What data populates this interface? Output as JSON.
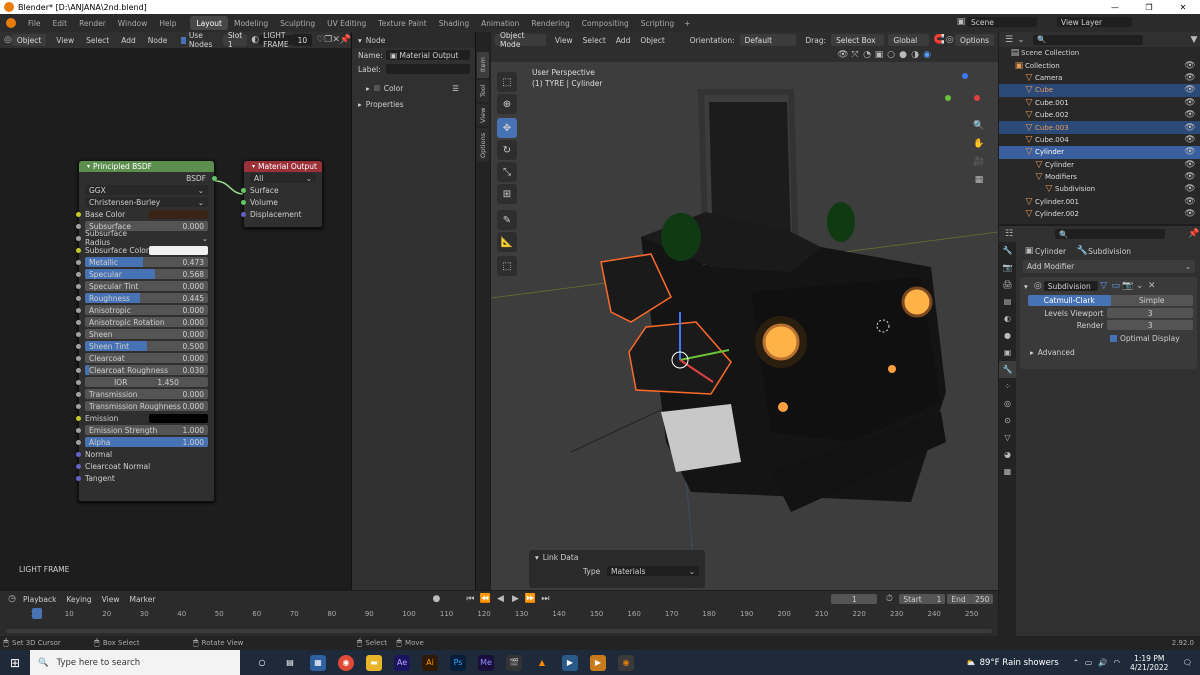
{
  "window": {
    "title": "Blender* [D:\\ANJANA\\2nd.blend]",
    "min": "—",
    "max": "❐",
    "close": "✕"
  },
  "menu": [
    "File",
    "Edit",
    "Render",
    "Window",
    "Help"
  ],
  "workspaces": [
    "Layout",
    "Modeling",
    "Sculpting",
    "UV Editing",
    "Texture Paint",
    "Shading",
    "Animation",
    "Rendering",
    "Compositing",
    "Scripting"
  ],
  "scene": "Scene",
  "view_layer": "View Layer",
  "node_header": {
    "mode": "Object",
    "view": "View",
    "select": "Select",
    "add": "Add",
    "node": "Node",
    "use_nodes": "Use Nodes",
    "slot": "Slot 1",
    "material": "LIGHT FRAME",
    "users": "10"
  },
  "bsdf": {
    "title": "Principled BSDF",
    "out": "BSDF",
    "distribution": "GGX",
    "subsurface_method": "Christensen-Burley",
    "base_color_label": "Base Color",
    "base_color": "#3a2418",
    "fields": [
      {
        "label": "Subsurface",
        "value": "0.000",
        "fill": 0
      },
      {
        "label": "Subsurface Radius",
        "value": "",
        "fill": 0,
        "dropdown": true
      },
      {
        "label": "Subsurface Color",
        "value": "",
        "fill": 0,
        "color": "#f0f0f0"
      },
      {
        "label": "Metallic",
        "value": "0.473",
        "fill": 0.473
      },
      {
        "label": "Specular",
        "value": "0.568",
        "fill": 0.568
      },
      {
        "label": "Specular Tint",
        "value": "0.000",
        "fill": 0
      },
      {
        "label": "Roughness",
        "value": "0.445",
        "fill": 0.445
      },
      {
        "label": "Anisotropic",
        "value": "0.000",
        "fill": 0
      },
      {
        "label": "Anisotropic Rotation",
        "value": "0.000",
        "fill": 0
      },
      {
        "label": "Sheen",
        "value": "0.000",
        "fill": 0
      },
      {
        "label": "Sheen Tint",
        "value": "0.500",
        "fill": 0.5
      },
      {
        "label": "Clearcoat",
        "value": "0.000",
        "fill": 0
      },
      {
        "label": "Clearcoat Roughness",
        "value": "0.030",
        "fill": 0.03
      },
      {
        "label": "IOR",
        "value": "1.450",
        "fill": 0,
        "center": true
      },
      {
        "label": "Transmission",
        "value": "0.000",
        "fill": 0
      },
      {
        "label": "Transmission Roughness",
        "value": "0.000",
        "fill": 0
      },
      {
        "label": "Emission",
        "value": "",
        "fill": 0,
        "color": "#000000",
        "plain": true
      },
      {
        "label": "Emission Strength",
        "value": "1.000",
        "fill": 0
      },
      {
        "label": "Alpha",
        "value": "1.000",
        "fill": 1
      }
    ],
    "inputs": [
      "Normal",
      "Clearcoat Normal",
      "Tangent"
    ]
  },
  "matout": {
    "title": "Material Output",
    "target": "All",
    "inputs": [
      "Surface",
      "Volume",
      "Displacement"
    ]
  },
  "node_editor_label": "LIGHT FRAME",
  "npanel": {
    "section": "Node",
    "name_label": "Name:",
    "name": "Material Output",
    "label_label": "Label:",
    "color": "Color",
    "properties": "Properties"
  },
  "ntabs": [
    "Item",
    "Tool",
    "View",
    "Options"
  ],
  "viewport": {
    "mode": "Object Mode",
    "view": "View",
    "select": "Select",
    "add": "Add",
    "object": "Object",
    "orientation_label": "Orientation:",
    "orientation": "Default",
    "drag_label": "Drag:",
    "drag": "Select Box",
    "transform": "Global",
    "options": "Options",
    "info1": "User Perspective",
    "info2": "(1) TYRE | Cylinder"
  },
  "link_panel": {
    "title": "Link Data",
    "type_label": "Type",
    "type": "Materials"
  },
  "outliner": {
    "root": "Scene Collection",
    "rows": [
      {
        "name": "Collection",
        "indent": 1,
        "color": "#ddd",
        "cls": ""
      },
      {
        "name": "Camera",
        "indent": 2,
        "color": "#ddd",
        "cls": ""
      },
      {
        "name": "Cube",
        "indent": 2,
        "color": "#e69a58",
        "cls": "sel"
      },
      {
        "name": "Cube.001",
        "indent": 2,
        "color": "#ddd",
        "cls": ""
      },
      {
        "name": "Cube.002",
        "indent": 2,
        "color": "#ddd",
        "cls": ""
      },
      {
        "name": "Cube.003",
        "indent": 2,
        "color": "#e69a58",
        "cls": "sel"
      },
      {
        "name": "Cube.004",
        "indent": 2,
        "color": "#ddd",
        "cls": ""
      },
      {
        "name": "Cylinder",
        "indent": 2,
        "color": "#fff",
        "cls": "act"
      },
      {
        "name": "Cylinder",
        "indent": 3,
        "color": "#ddd",
        "cls": ""
      },
      {
        "name": "Modifiers",
        "indent": 3,
        "color": "#ddd",
        "cls": ""
      },
      {
        "name": "Subdivision",
        "indent": 4,
        "color": "#ddd",
        "cls": ""
      },
      {
        "name": "Cylinder.001",
        "indent": 2,
        "color": "#ddd",
        "cls": ""
      },
      {
        "name": "Cylinder.002",
        "indent": 2,
        "color": "#ddd",
        "cls": ""
      }
    ]
  },
  "props": {
    "object": "Cylinder",
    "modifier": "Subdivision",
    "add_modifier": "Add Modifier",
    "mod_name": "Subdivision",
    "catmull": "Catmull-Clark",
    "simple": "Simple",
    "levels_label": "Levels Viewport",
    "levels": "3",
    "render_label": "Render",
    "render": "3",
    "optimal": "Optimal Display",
    "advanced": "Advanced"
  },
  "timeline": {
    "playback": "Playback",
    "keying": "Keying",
    "view": "View",
    "marker": "Marker",
    "frame": "1",
    "start_label": "Start",
    "start": "1",
    "end_label": "End",
    "end": "250",
    "ticks": [
      "1",
      "10",
      "20",
      "30",
      "40",
      "50",
      "60",
      "70",
      "80",
      "90",
      "100",
      "110",
      "120",
      "130",
      "140",
      "150",
      "160",
      "170",
      "180",
      "190",
      "200",
      "210",
      "220",
      "230",
      "240",
      "250"
    ]
  },
  "status": {
    "s1": "Set 3D Cursor",
    "s2": "Box Select",
    "s3": "Rotate View",
    "s4": "Select",
    "s5": "Move",
    "version": "2.92.0"
  },
  "taskbar": {
    "search": "Type here to search",
    "weather": "89°F  Rain showers",
    "time": "1:19 PM",
    "date": "4/21/2022"
  }
}
